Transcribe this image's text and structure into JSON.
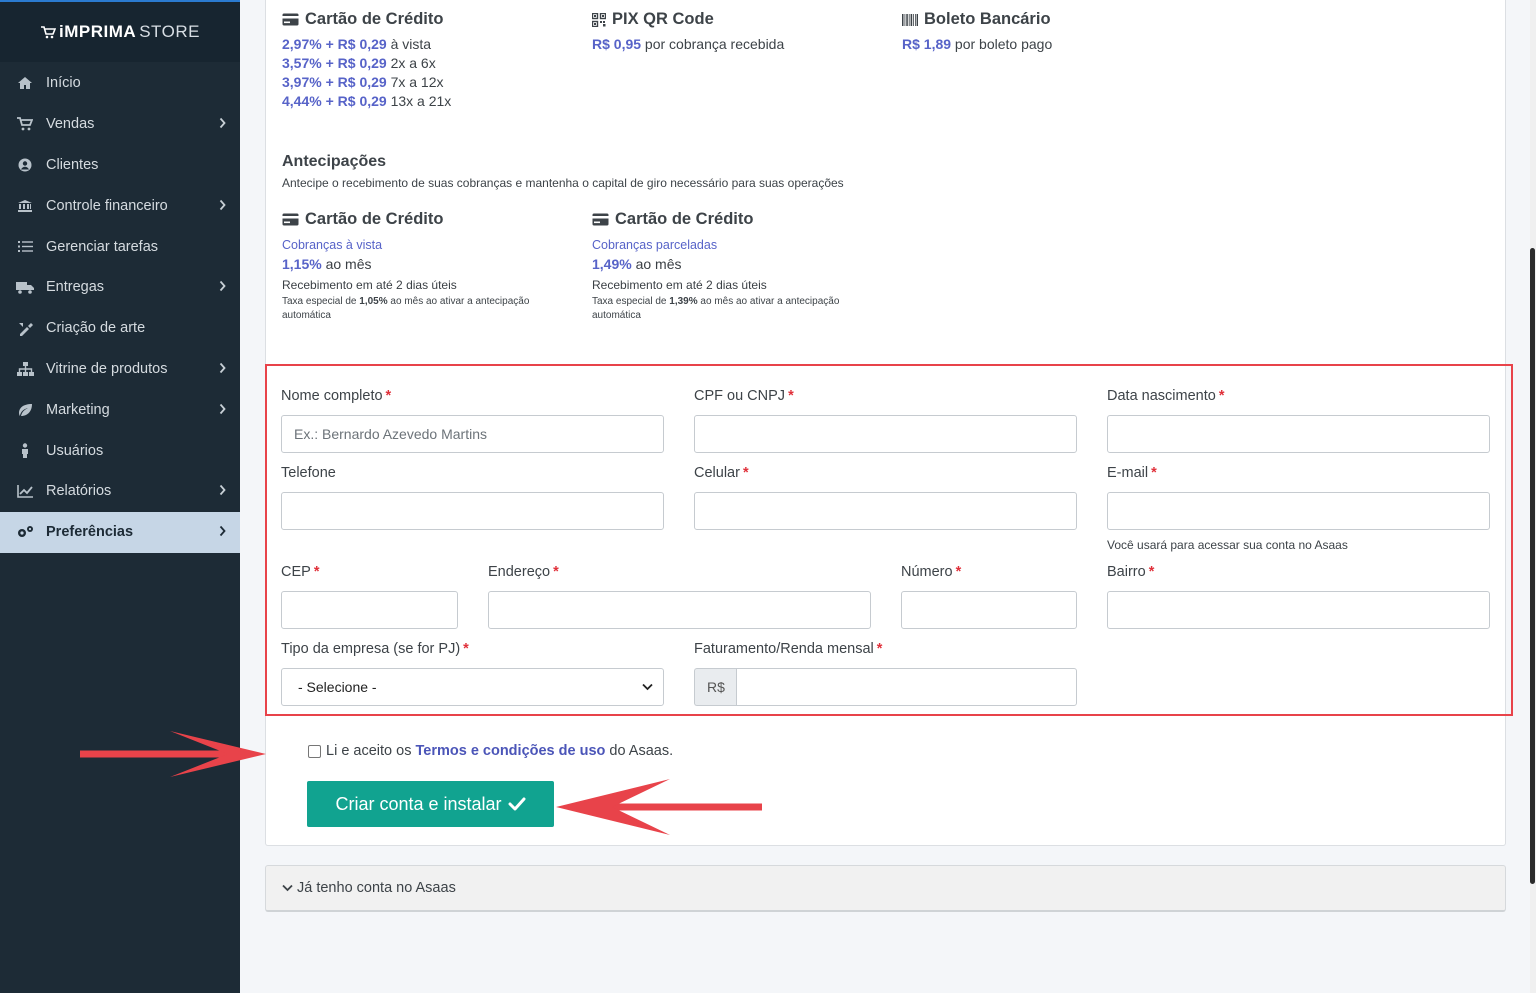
{
  "app": {
    "logo_bold": "iMPRIMA",
    "logo_light": "STORE"
  },
  "sidebar": {
    "items": [
      {
        "label": "Início",
        "icon": "home-icon",
        "chevron": false
      },
      {
        "label": "Vendas",
        "icon": "cart-icon",
        "chevron": true
      },
      {
        "label": "Clientes",
        "icon": "user-circle-icon",
        "chevron": false
      },
      {
        "label": "Controle financeiro",
        "icon": "bank-icon",
        "chevron": true
      },
      {
        "label": "Gerenciar tarefas",
        "icon": "tasks-icon",
        "chevron": false
      },
      {
        "label": "Entregas",
        "icon": "truck-icon",
        "chevron": true
      },
      {
        "label": "Criação de arte",
        "icon": "brush-icon",
        "chevron": false
      },
      {
        "label": "Vitrine de produtos",
        "icon": "sitemap-icon",
        "chevron": true
      },
      {
        "label": "Marketing",
        "icon": "leaf-icon",
        "chevron": true
      },
      {
        "label": "Usuários",
        "icon": "person-icon",
        "chevron": false
      },
      {
        "label": "Relatórios",
        "icon": "chart-icon",
        "chevron": true
      },
      {
        "label": "Preferências",
        "icon": "gears-icon",
        "chevron": true,
        "active": true
      }
    ]
  },
  "fees": {
    "credit": {
      "title": "Cartão de Crédito",
      "lines": [
        {
          "rate": "2,97% + R$ 0,29",
          "desc": " à vista"
        },
        {
          "rate": "3,57% + R$ 0,29",
          "desc": " 2x a 6x"
        },
        {
          "rate": "3,97% + R$ 0,29",
          "desc": " 7x a 12x"
        },
        {
          "rate": "4,44% + R$ 0,29",
          "desc": " 13x a 21x"
        }
      ]
    },
    "pix": {
      "title": "PIX QR Code",
      "rate": "R$ 0,95",
      "desc": " por cobrança recebida"
    },
    "boleto": {
      "title": "Boleto Bancário",
      "rate": "R$ 1,89",
      "desc": " por boleto pago"
    }
  },
  "antecipacoes": {
    "title": "Antecipações",
    "subtitle": "Antecipe o recebimento de suas cobranças e mantenha o capital de giro necessário para suas operações",
    "cards": [
      {
        "title": "Cartão de Crédito",
        "link": "Cobranças à vista",
        "rate": "1,15%",
        "rate_suffix": " ao mês",
        "info": "Recebimento em até 2 dias úteis",
        "small_prefix": "Taxa especial de ",
        "small_rate": "1,05%",
        "small_suffix": " ao mês ao ativar a antecipação automática"
      },
      {
        "title": "Cartão de Crédito",
        "link": "Cobranças parceladas",
        "rate": "1,49%",
        "rate_suffix": " ao mês",
        "info": "Recebimento em até 2 dias úteis",
        "small_prefix": "Taxa especial de ",
        "small_rate": "1,39%",
        "small_suffix": " ao mês ao ativar a antecipação automática"
      }
    ]
  },
  "form": {
    "nome": {
      "label": "Nome completo",
      "placeholder": "Ex.: Bernardo Azevedo Martins"
    },
    "cpf": {
      "label": "CPF ou CNPJ"
    },
    "nascimento": {
      "label": "Data nascimento"
    },
    "telefone": {
      "label": "Telefone"
    },
    "celular": {
      "label": "Celular"
    },
    "email": {
      "label": "E-mail",
      "help": "Você usará para acessar sua conta no Asaas"
    },
    "cep": {
      "label": "CEP"
    },
    "endereco": {
      "label": "Endereço"
    },
    "numero": {
      "label": "Número"
    },
    "bairro": {
      "label": "Bairro"
    },
    "tipo": {
      "label": "Tipo da empresa (se for PJ)",
      "selected": "- Selecione -"
    },
    "faturamento": {
      "label": "Faturamento/Renda mensal",
      "prefix": "R$"
    },
    "required_mark": "*"
  },
  "terms": {
    "before": "Li e aceito os ",
    "link": "Termos e condições de uso",
    "after": " do Asaas."
  },
  "cta": {
    "label": "Criar conta e instalar"
  },
  "accordion": {
    "label": "Já tenho conta no Asaas"
  },
  "colors": {
    "accent": "#5763c8",
    "cta": "#11a390",
    "highlight": "#e8434a",
    "sidebar_bg": "#1d2b36"
  }
}
